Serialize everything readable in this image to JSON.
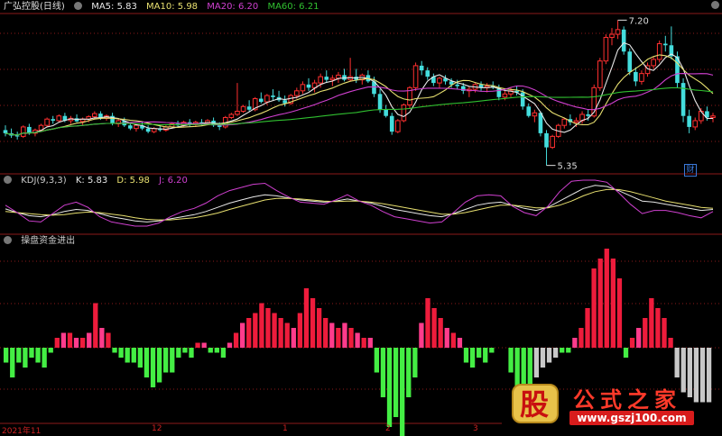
{
  "header": {
    "stock_name": "广弘控股(日线)",
    "ma5_label": "MA5: 5.83",
    "ma10_label": "MA10: 5.98",
    "ma20_label": "MA20: 6.20",
    "ma60_label": "MA60: 6.21"
  },
  "kdj_header": {
    "name": "KDJ(9,3,3)",
    "k_label": "K: 5.83",
    "d_label": "D: 5.98",
    "j_label": "J: 6.20"
  },
  "lower_header": {
    "name": "操盘资金进出"
  },
  "annotations": {
    "high": "7.20",
    "low": "5.35",
    "cai": "财"
  },
  "x_axis_labels": [
    "2021年11",
    "12",
    "1",
    "2",
    "3"
  ],
  "watermark": {
    "char": "股",
    "title": "公式之家",
    "url": "www.gszj100.com"
  },
  "colors": {
    "up": "#ff3030",
    "down": "#44dddd",
    "ma5": "#e8e8e8",
    "ma10": "#e8e070",
    "ma20": "#d040d0",
    "ma60": "#30c030",
    "bar_red": "#ee1c3c",
    "bar_pink": "#ff3c8c",
    "bar_green": "#44ee44",
    "bar_gray": "#c8c8c8",
    "grid": "#8c1a1a"
  },
  "chart_data": [
    {
      "type": "candlestick",
      "title": "广弘控股(日线)",
      "ylim": [
        5.3,
        7.25
      ],
      "annotated_high": 7.2,
      "annotated_low": 5.35,
      "ohlc": [
        [
          5.8,
          5.86,
          5.72,
          5.76
        ],
        [
          5.76,
          5.82,
          5.7,
          5.73
        ],
        [
          5.73,
          5.78,
          5.68,
          5.72
        ],
        [
          5.72,
          5.86,
          5.7,
          5.84
        ],
        [
          5.84,
          5.88,
          5.74,
          5.76
        ],
        [
          5.76,
          5.82,
          5.72,
          5.8
        ],
        [
          5.8,
          5.88,
          5.78,
          5.86
        ],
        [
          5.86,
          5.96,
          5.84,
          5.94
        ],
        [
          5.94,
          5.98,
          5.88,
          5.92
        ],
        [
          5.92,
          6.0,
          5.9,
          5.98
        ],
        [
          5.98,
          6.02,
          5.9,
          5.92
        ],
        [
          5.92,
          5.98,
          5.88,
          5.95
        ],
        [
          5.95,
          6.0,
          5.9,
          5.91
        ],
        [
          5.91,
          5.96,
          5.86,
          5.94
        ],
        [
          5.94,
          5.99,
          5.9,
          5.97
        ],
        [
          5.97,
          6.04,
          5.94,
          6.01
        ],
        [
          6.01,
          6.04,
          5.93,
          5.95
        ],
        [
          5.95,
          6.0,
          5.92,
          5.98
        ],
        [
          5.98,
          6.02,
          5.86,
          5.88
        ],
        [
          5.88,
          5.94,
          5.84,
          5.92
        ],
        [
          5.92,
          5.96,
          5.84,
          5.86
        ],
        [
          5.86,
          5.9,
          5.8,
          5.82
        ],
        [
          5.82,
          5.88,
          5.78,
          5.86
        ],
        [
          5.86,
          5.9,
          5.8,
          5.82
        ],
        [
          5.82,
          5.86,
          5.76,
          5.78
        ],
        [
          5.78,
          5.84,
          5.76,
          5.82
        ],
        [
          5.82,
          5.86,
          5.78,
          5.8
        ],
        [
          5.8,
          5.86,
          5.78,
          5.84
        ],
        [
          5.84,
          5.9,
          5.82,
          5.88
        ],
        [
          5.88,
          5.92,
          5.84,
          5.86
        ],
        [
          5.86,
          5.92,
          5.84,
          5.9
        ],
        [
          5.9,
          5.94,
          5.84,
          5.87
        ],
        [
          5.87,
          5.92,
          5.84,
          5.9
        ],
        [
          5.9,
          5.94,
          5.86,
          5.89
        ],
        [
          5.89,
          5.94,
          5.86,
          5.92
        ],
        [
          5.92,
          5.96,
          5.84,
          5.86
        ],
        [
          5.86,
          5.9,
          5.8,
          5.84
        ],
        [
          5.84,
          5.98,
          5.82,
          5.96
        ],
        [
          5.96,
          6.02,
          5.94,
          6.0
        ],
        [
          6.0,
          6.4,
          5.98,
          6.04
        ],
        [
          6.04,
          6.12,
          6.02,
          6.1
        ],
        [
          6.1,
          6.18,
          6.04,
          6.06
        ],
        [
          6.06,
          6.22,
          6.04,
          6.2
        ],
        [
          6.2,
          6.28,
          6.14,
          6.16
        ],
        [
          6.16,
          6.26,
          6.12,
          6.24
        ],
        [
          6.24,
          6.32,
          6.18,
          6.22
        ],
        [
          6.22,
          6.3,
          6.16,
          6.18
        ],
        [
          6.18,
          6.24,
          6.1,
          6.14
        ],
        [
          6.14,
          6.26,
          6.12,
          6.24
        ],
        [
          6.24,
          6.34,
          6.2,
          6.3
        ],
        [
          6.3,
          6.42,
          6.26,
          6.38
        ],
        [
          6.38,
          6.46,
          6.3,
          6.34
        ],
        [
          6.34,
          6.44,
          6.28,
          6.4
        ],
        [
          6.4,
          6.52,
          6.34,
          6.48
        ],
        [
          6.48,
          6.56,
          6.4,
          6.44
        ],
        [
          6.44,
          6.5,
          6.36,
          6.46
        ],
        [
          6.46,
          6.54,
          6.4,
          6.5
        ],
        [
          6.5,
          6.58,
          6.42,
          6.44
        ],
        [
          6.44,
          6.72,
          6.42,
          6.48
        ],
        [
          6.48,
          6.58,
          6.4,
          6.44
        ],
        [
          6.44,
          6.52,
          6.38,
          6.5
        ],
        [
          6.5,
          6.56,
          6.4,
          6.42
        ],
        [
          6.42,
          6.48,
          6.22,
          6.26
        ],
        [
          6.26,
          6.32,
          6.02,
          6.06
        ],
        [
          6.06,
          6.12,
          5.96,
          5.98
        ],
        [
          5.98,
          6.02,
          5.74,
          5.78
        ],
        [
          5.78,
          5.94,
          5.76,
          5.92
        ],
        [
          5.92,
          6.14,
          5.9,
          6.12
        ],
        [
          6.12,
          6.36,
          6.08,
          6.34
        ],
        [
          6.34,
          6.66,
          6.3,
          6.62
        ],
        [
          6.62,
          6.68,
          6.5,
          6.56
        ],
        [
          6.56,
          6.6,
          6.44,
          6.48
        ],
        [
          6.48,
          6.52,
          6.36,
          6.4
        ],
        [
          6.4,
          6.48,
          6.34,
          6.46
        ],
        [
          6.46,
          6.5,
          6.38,
          6.42
        ],
        [
          6.42,
          6.46,
          6.34,
          6.38
        ],
        [
          6.38,
          6.44,
          6.32,
          6.36
        ],
        [
          6.36,
          6.4,
          6.26,
          6.3
        ],
        [
          6.3,
          6.36,
          6.22,
          6.32
        ],
        [
          6.32,
          6.4,
          6.28,
          6.38
        ],
        [
          6.38,
          6.42,
          6.3,
          6.34
        ],
        [
          6.34,
          6.4,
          6.28,
          6.36
        ],
        [
          6.36,
          6.42,
          6.32,
          6.34
        ],
        [
          6.34,
          6.38,
          6.18,
          6.22
        ],
        [
          6.22,
          6.3,
          6.18,
          6.26
        ],
        [
          6.26,
          6.34,
          6.22,
          6.3
        ],
        [
          6.3,
          6.36,
          6.24,
          6.28
        ],
        [
          6.28,
          6.32,
          6.06,
          6.1
        ],
        [
          6.1,
          6.14,
          5.96,
          5.98
        ],
        [
          5.98,
          6.06,
          5.9,
          6.02
        ],
        [
          6.02,
          6.04,
          5.72,
          5.76
        ],
        [
          5.76,
          5.8,
          5.35,
          5.58
        ],
        [
          5.58,
          5.74,
          5.56,
          5.72
        ],
        [
          5.72,
          5.88,
          5.7,
          5.86
        ],
        [
          5.86,
          5.96,
          5.82,
          5.94
        ],
        [
          5.94,
          6.0,
          5.86,
          5.9
        ],
        [
          5.9,
          5.96,
          5.84,
          5.92
        ],
        [
          5.92,
          6.04,
          5.88,
          6.0
        ],
        [
          6.0,
          6.06,
          5.92,
          5.98
        ],
        [
          5.98,
          6.38,
          5.96,
          6.34
        ],
        [
          6.34,
          6.72,
          6.3,
          6.68
        ],
        [
          6.68,
          7.02,
          6.64,
          6.98
        ],
        [
          6.98,
          7.1,
          6.88,
          7.02
        ],
        [
          7.02,
          7.2,
          6.96,
          7.08
        ],
        [
          7.08,
          7.12,
          6.76,
          6.8
        ],
        [
          6.8,
          6.84,
          6.5,
          6.54
        ],
        [
          6.54,
          6.6,
          6.36,
          6.42
        ],
        [
          6.42,
          6.56,
          6.38,
          6.52
        ],
        [
          6.52,
          6.66,
          6.48,
          6.62
        ],
        [
          6.62,
          6.74,
          6.58,
          6.7
        ],
        [
          6.7,
          6.94,
          6.66,
          6.9
        ],
        [
          6.9,
          7.0,
          6.8,
          6.88
        ],
        [
          6.88,
          7.12,
          6.7,
          6.74
        ],
        [
          6.74,
          6.8,
          6.34,
          6.4
        ],
        [
          6.4,
          6.46,
          5.9,
          5.98
        ],
        [
          5.98,
          6.06,
          5.76,
          5.84
        ],
        [
          5.84,
          5.96,
          5.8,
          5.92
        ],
        [
          5.92,
          6.08,
          5.88,
          6.04
        ],
        [
          6.04,
          6.1,
          5.92,
          5.96
        ],
        [
          5.96,
          6.02,
          5.9,
          5.98
        ]
      ]
    },
    {
      "type": "line",
      "title": "KDJ(9,3,3)",
      "series": [
        {
          "name": "K",
          "values": [
            45,
            38,
            32,
            30,
            34,
            40,
            44,
            42,
            36,
            30,
            26,
            22,
            20,
            22,
            26,
            30,
            34,
            40,
            48,
            56,
            62,
            68,
            72,
            70,
            66,
            62,
            60,
            58,
            60,
            64,
            60,
            56,
            50,
            44,
            40,
            36,
            32,
            30,
            36,
            44,
            52,
            56,
            58,
            52,
            46,
            42,
            48,
            60,
            72,
            84,
            90,
            88,
            80,
            70,
            60,
            58,
            54,
            50,
            46,
            42,
            44
          ]
        },
        {
          "name": "D",
          "values": [
            40,
            38,
            36,
            34,
            33,
            34,
            37,
            39,
            38,
            35,
            32,
            28,
            25,
            24,
            24,
            26,
            28,
            32,
            37,
            44,
            50,
            56,
            62,
            65,
            65,
            64,
            62,
            60,
            59,
            60,
            60,
            58,
            55,
            51,
            47,
            43,
            39,
            35,
            35,
            38,
            43,
            48,
            52,
            52,
            50,
            47,
            47,
            52,
            60,
            70,
            78,
            82,
            82,
            78,
            72,
            66,
            60,
            56,
            52,
            48,
            46
          ]
        },
        {
          "name": "J",
          "values": [
            52,
            38,
            22,
            20,
            36,
            52,
            58,
            48,
            30,
            20,
            16,
            12,
            12,
            18,
            30,
            40,
            46,
            56,
            70,
            80,
            86,
            92,
            94,
            80,
            68,
            58,
            56,
            54,
            62,
            72,
            60,
            52,
            40,
            30,
            26,
            22,
            18,
            20,
            38,
            58,
            70,
            72,
            70,
            50,
            38,
            32,
            50,
            78,
            98,
            100,
            100,
            96,
            76,
            54,
            36,
            42,
            42,
            38,
            32,
            28,
            40
          ]
        }
      ]
    },
    {
      "type": "bar",
      "title": "操盘资金进出",
      "values": [
        -3,
        -6,
        -3,
        -4,
        -2,
        -3,
        -4,
        -1,
        2,
        3,
        3,
        2,
        2,
        3,
        9,
        4,
        3,
        -1,
        -2,
        -3,
        -3,
        -4,
        -6,
        -8,
        -7,
        -5,
        -5,
        -2,
        -1,
        -2,
        1,
        1,
        -1,
        -1,
        -2,
        1,
        3,
        5,
        6,
        7,
        9,
        8,
        7,
        6,
        5,
        4,
        7,
        12,
        10,
        8,
        6,
        5,
        4,
        5,
        4,
        3,
        2,
        2,
        -5,
        -10,
        -16,
        -14,
        -18,
        -10,
        -6,
        5,
        10,
        8,
        6,
        4,
        3,
        2,
        -3,
        -4,
        -2,
        -3,
        -1,
        0,
        0,
        -5,
        -10,
        -12,
        -9,
        -6,
        -4,
        -3,
        -2,
        -1,
        -1,
        2,
        4,
        8,
        16,
        18,
        20,
        18,
        14,
        -2,
        2,
        4,
        6,
        10,
        8,
        6,
        2,
        -6,
        -9,
        -10,
        -11,
        -11,
        -11
      ]
    }
  ]
}
